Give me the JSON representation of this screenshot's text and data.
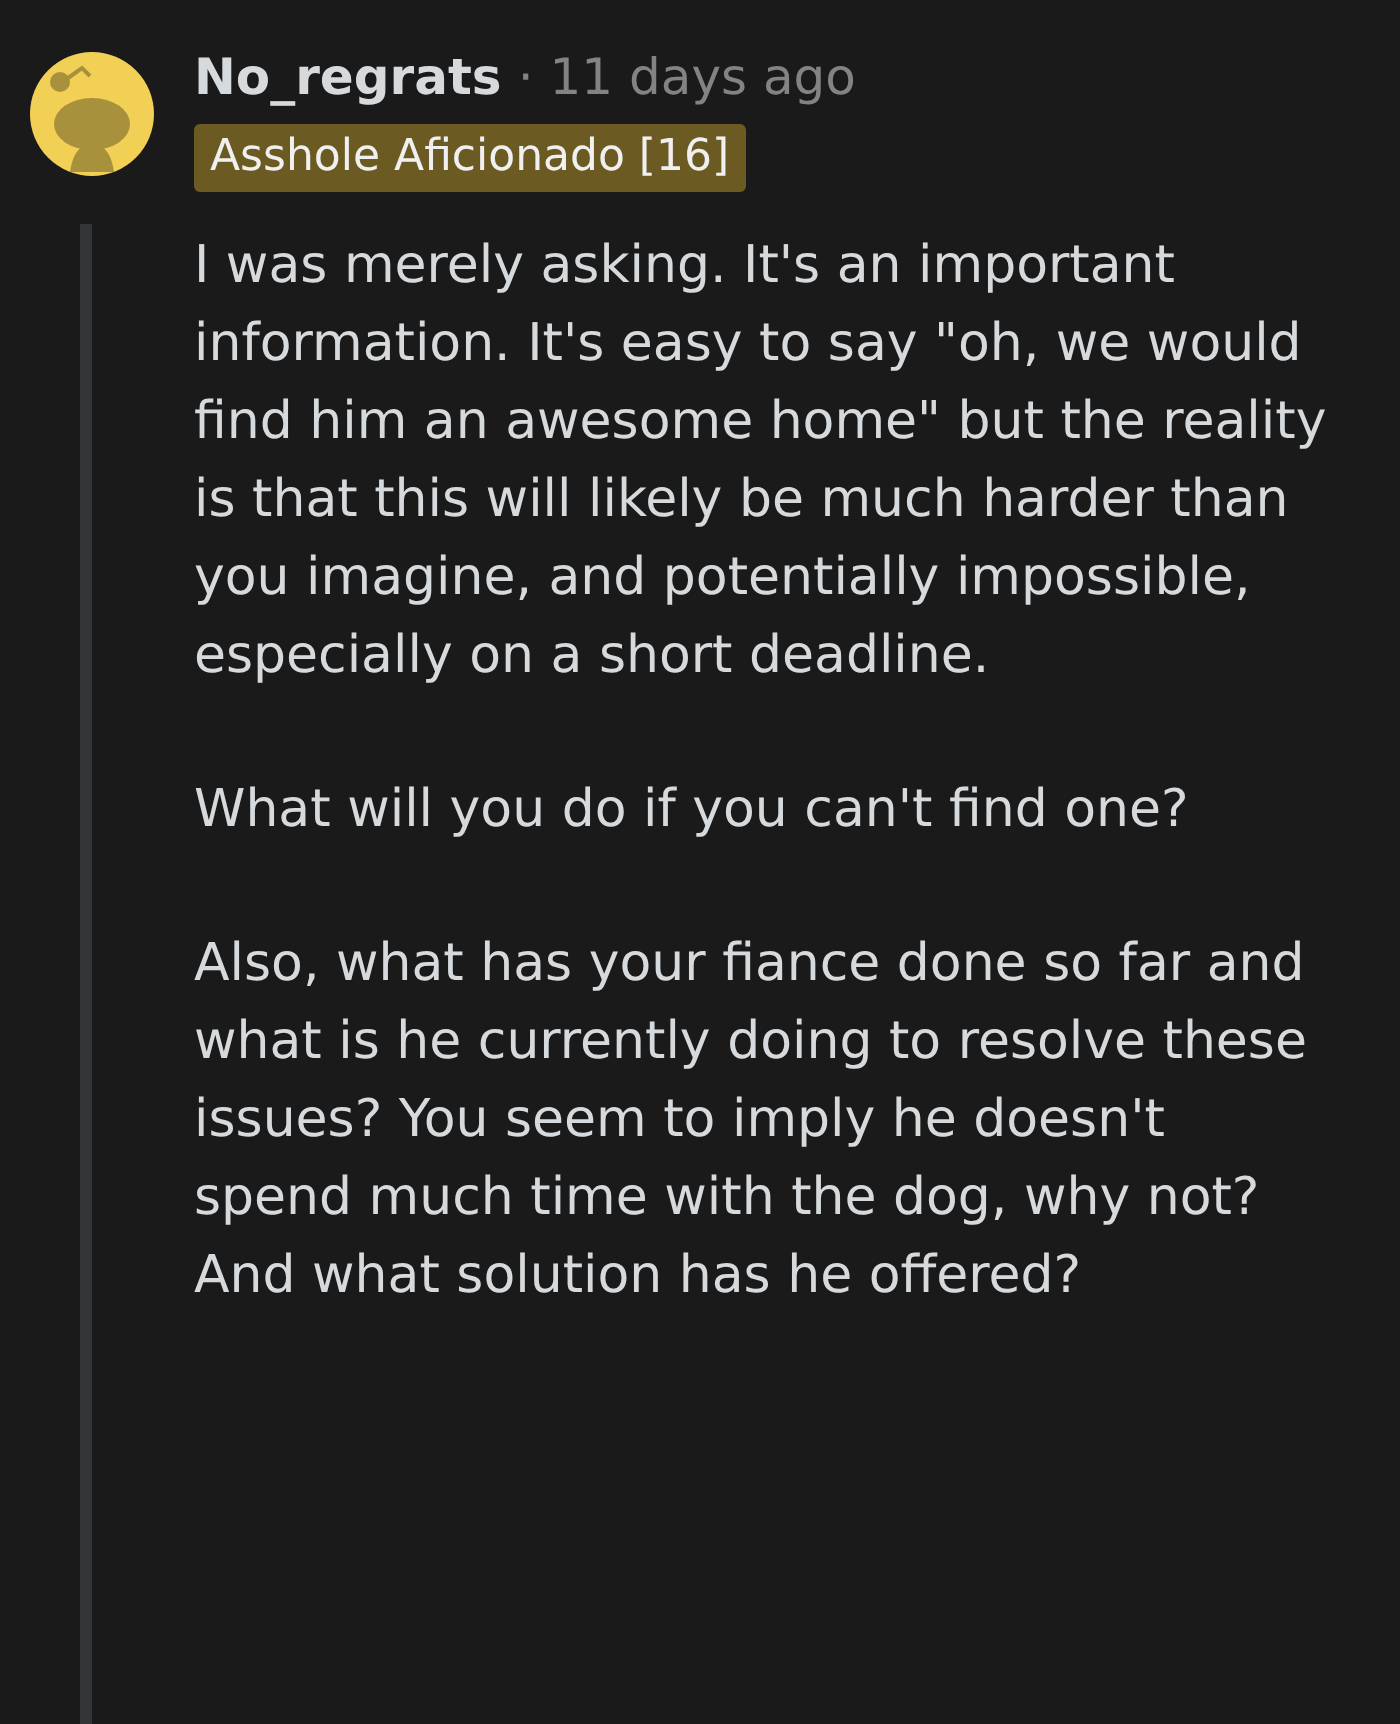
{
  "comment": {
    "author": "No_regrats",
    "separator": "·",
    "time": "11 days ago",
    "flair": "Asshole Aficionado [16]",
    "paragraphs": [
      "I was merely asking. It's an important information. It's easy to say \"oh, we would find him an awesome home\" but the reality is that this will likely be much harder than you imagine, and potentially impossible, especially on a short deadline.",
      "What will you do if you can't find one?",
      "Also, what has your fiance done so far and what is he currently doing to resolve these issues? You seem to imply he doesn't spend much time with the dog, why not? And what solution has he offered?"
    ]
  }
}
